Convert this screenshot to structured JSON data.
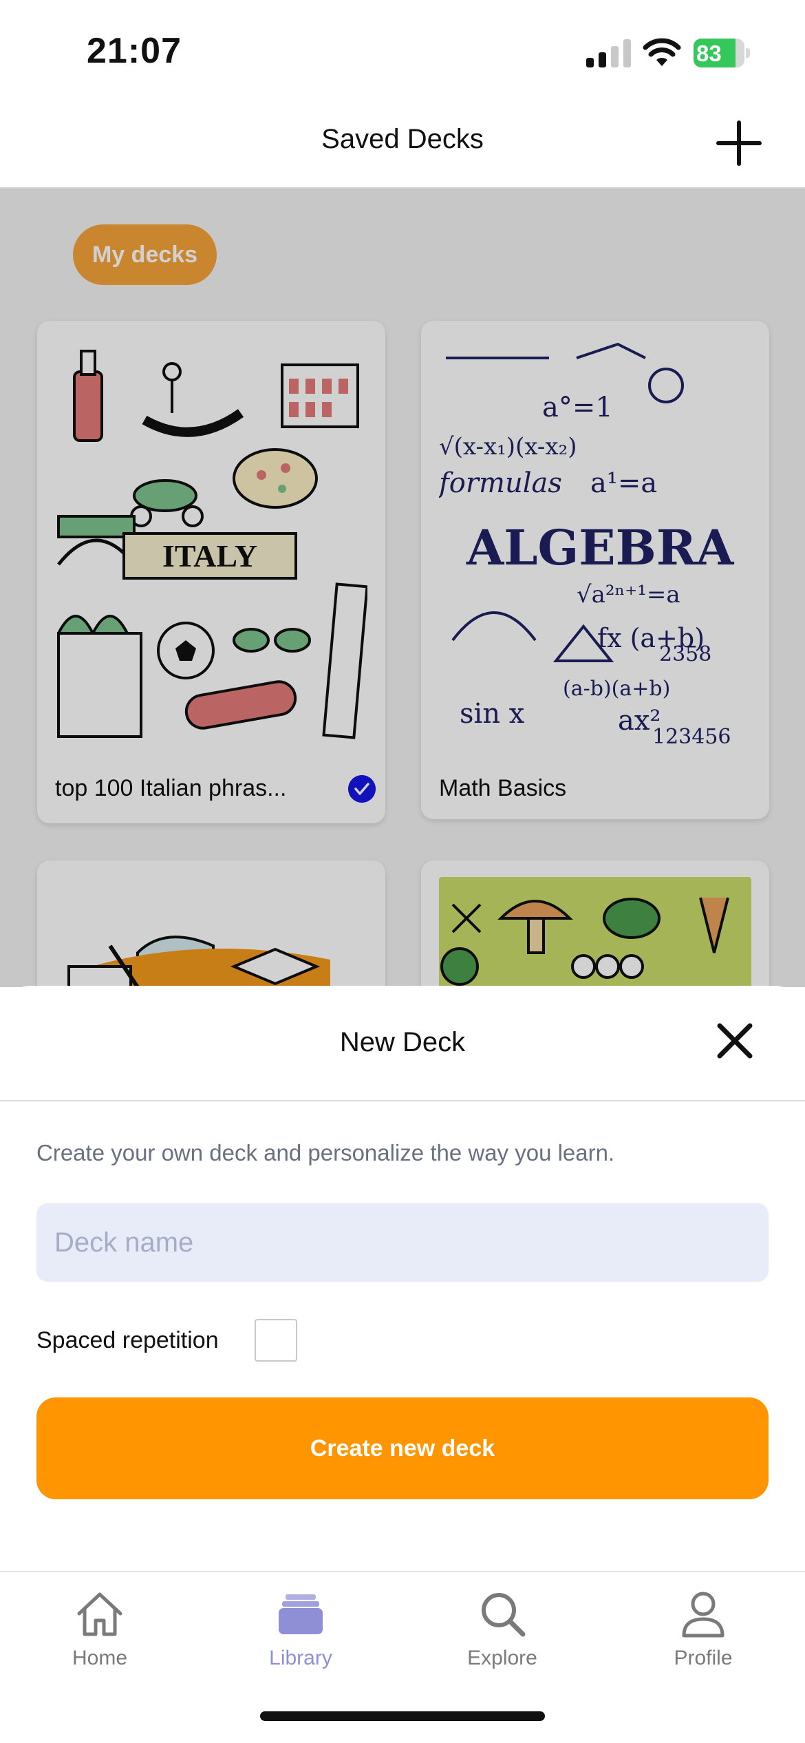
{
  "status": {
    "time": "21:07",
    "battery": "83",
    "battery_level": 0.83
  },
  "header": {
    "title": "Saved Decks"
  },
  "filter": {
    "chip_label": "My decks"
  },
  "decks": [
    {
      "label": "top 100 Italian phras...",
      "selected": true
    },
    {
      "label": "Math Basics",
      "selected": false
    }
  ],
  "sheet": {
    "title": "New Deck",
    "description": "Create your own deck and personalize the way you learn.",
    "deck_name_placeholder": "Deck name",
    "spaced_repetition_label": "Spaced repetition",
    "spaced_repetition_checked": false,
    "create_button_label": "Create new deck"
  },
  "tabs": [
    {
      "label": "Home",
      "icon": "home-icon",
      "active": false
    },
    {
      "label": "Library",
      "icon": "library-icon",
      "active": true
    },
    {
      "label": "Explore",
      "icon": "search-icon",
      "active": false
    },
    {
      "label": "Profile",
      "icon": "person-icon",
      "active": false
    }
  ],
  "colors": {
    "accent": "#ff9500",
    "tab_active": "#8f8fd6",
    "check": "#1616e6",
    "input_bg": "#e8ecf8"
  }
}
